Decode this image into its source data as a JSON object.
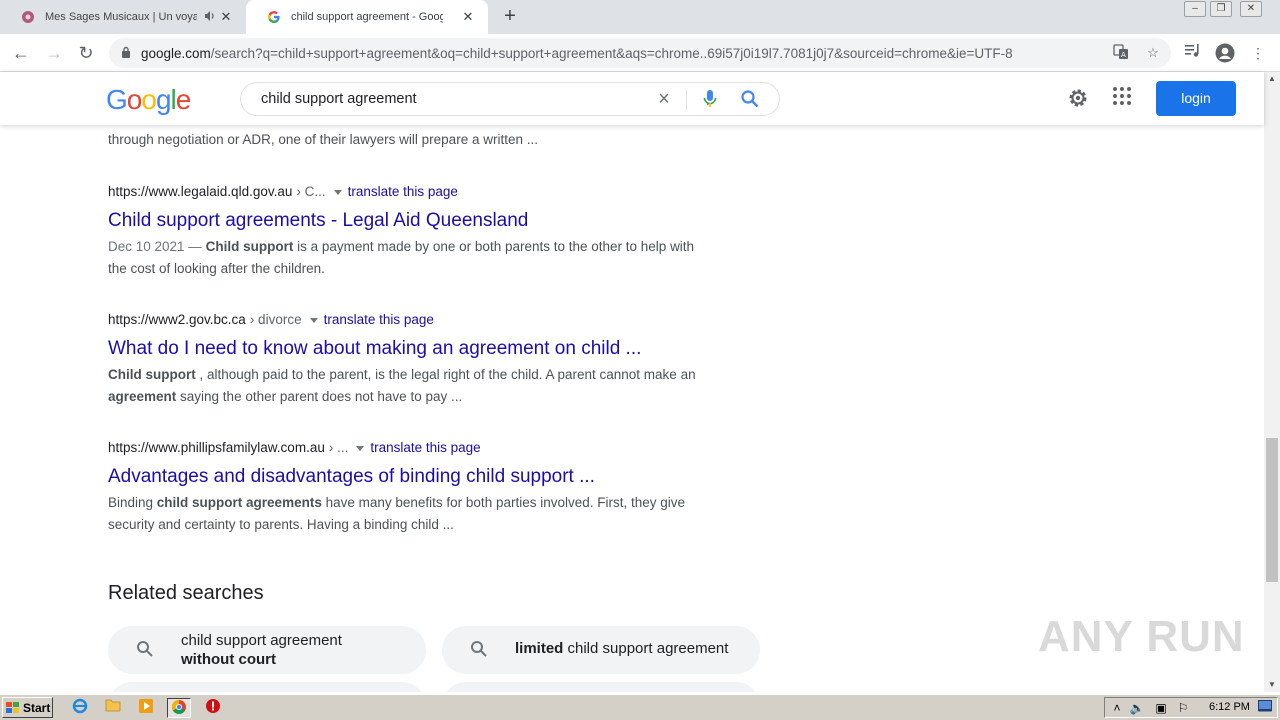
{
  "browser": {
    "tabs": [
      {
        "title": "Mes Sages Musicaux | Un voyage",
        "active": false,
        "audio_icon": "speaker-icon"
      },
      {
        "title": "child support agreement - Google Search",
        "active": true
      }
    ],
    "new_tab": "+",
    "url_host": "google.com",
    "url_path": "/search?q=child+support+agreement&oq=child+support+agreement&aqs=chrome..69i57j0i19l7.7081j0j7&sourceid=chrome&ie=UTF-8"
  },
  "search": {
    "logo_letters": [
      "G",
      "o",
      "o",
      "g",
      "l",
      "e"
    ],
    "logo_colors": [
      "#4285f4",
      "#ea4335",
      "#fbbc05",
      "#4285f4",
      "#34a853",
      "#ea4335"
    ],
    "query": "child support agreement",
    "login_label": "login"
  },
  "fragment_line": "through negotiation or ADR, one of their lawyers will prepare a written ...",
  "results": [
    {
      "site": "https://www.legalaid.qld.gov.au",
      "crumb": "› C...",
      "translate": "translate this page",
      "title": "Child support agreements - Legal Aid Queensland",
      "date": "Dec 10 2021 —",
      "b1": "Child support",
      "s1": " is a payment made by one or both parents to the other to help with the cost of looking after the children."
    },
    {
      "site": "https://www2.gov.bc.ca",
      "crumb": "› divorce",
      "translate": "translate this page",
      "title": "What do I need to know about making an agreement on child ...",
      "b1": "Child support",
      "s1": " , although paid to the parent, is the legal right of the child. A parent cannot make an ",
      "b2": "agreement",
      "s2": " saying the other parent does not have to pay ..."
    },
    {
      "site": "https://www.phillipsfamilylaw.com.au",
      "crumb": "› ...",
      "translate": "translate this page",
      "title": "Advantages and disadvantages of binding child support ...",
      "s0": "Binding ",
      "b1": "child support agreements",
      "s1": " have many benefits for both parties involved. First, they give security and certainty to parents. Having a binding child ..."
    }
  ],
  "related": {
    "heading": "Related searches",
    "chip1": {
      "line1": "child support agreement",
      "line2": "without court"
    },
    "chip2": {
      "bold": "limited",
      "rest": " child support agreement"
    }
  },
  "watermark": "ANY RUN",
  "taskbar": {
    "start_label": "Start",
    "clock": "6:12 PM"
  },
  "colors": {
    "link": "#1a0dab",
    "login": "#1a73e8"
  }
}
